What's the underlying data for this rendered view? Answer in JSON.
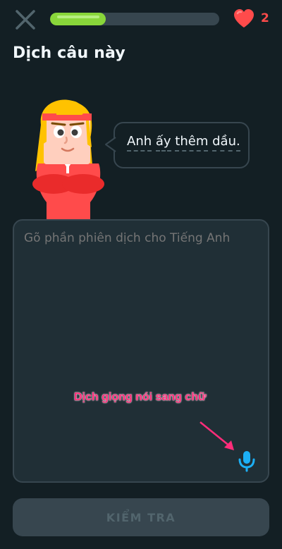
{
  "header": {
    "progress_fraction": 0.33,
    "hearts_count": "2",
    "colors": {
      "progress_fill": "#89d63a",
      "heart": "#ff4b4b"
    }
  },
  "lesson": {
    "title": "Dịch câu này",
    "sentence_words": [
      "Anh",
      "ấy",
      "thêm",
      "dầu."
    ]
  },
  "answer": {
    "placeholder": "Gõ phần phiên dịch cho Tiếng Anh",
    "value": ""
  },
  "annotation": {
    "text": "Dịch giọng nói sang chữ"
  },
  "footer": {
    "check_label": "KIỂM TRA"
  },
  "icons": [
    "close-icon",
    "heart-icon",
    "microphone-icon"
  ]
}
